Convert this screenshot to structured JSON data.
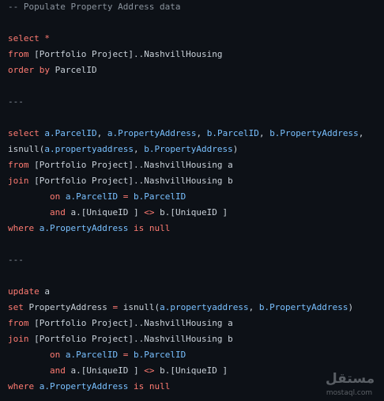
{
  "code_lines": [
    [
      {
        "t": "cm",
        "v": "-- Populate Property Address data"
      }
    ],
    [],
    [
      {
        "t": "kw",
        "v": "select"
      },
      {
        "t": "txt",
        "v": " "
      },
      {
        "t": "kw",
        "v": "*"
      }
    ],
    [
      {
        "t": "kw",
        "v": "from"
      },
      {
        "t": "txt",
        "v": " [Portfolio Project]..NashvillHousing"
      }
    ],
    [
      {
        "t": "kw",
        "v": "order by"
      },
      {
        "t": "txt",
        "v": " ParcelID"
      }
    ],
    [],
    [
      {
        "t": "cm",
        "v": "---"
      }
    ],
    [],
    [
      {
        "t": "kw",
        "v": "select"
      },
      {
        "t": "txt",
        "v": " "
      },
      {
        "t": "id",
        "v": "a.ParcelID"
      },
      {
        "t": "txt",
        "v": ", "
      },
      {
        "t": "id",
        "v": "a.PropertyAddress"
      },
      {
        "t": "txt",
        "v": ", "
      },
      {
        "t": "id",
        "v": "b.ParcelID"
      },
      {
        "t": "txt",
        "v": ", "
      },
      {
        "t": "id",
        "v": "b.PropertyAddress"
      },
      {
        "t": "txt",
        "v": ","
      }
    ],
    [
      {
        "t": "txt",
        "v": "isnull("
      },
      {
        "t": "id",
        "v": "a.propertyaddress"
      },
      {
        "t": "txt",
        "v": ", "
      },
      {
        "t": "id",
        "v": "b.PropertyAddress"
      },
      {
        "t": "txt",
        "v": ")"
      }
    ],
    [
      {
        "t": "kw",
        "v": "from"
      },
      {
        "t": "txt",
        "v": " [Portfolio Project]..NashvillHousing a"
      }
    ],
    [
      {
        "t": "kw",
        "v": "join"
      },
      {
        "t": "txt",
        "v": " [Portfolio Project]..NashvillHousing b"
      }
    ],
    [
      {
        "t": "txt",
        "v": "        "
      },
      {
        "t": "kw",
        "v": "on"
      },
      {
        "t": "txt",
        "v": " "
      },
      {
        "t": "id",
        "v": "a.ParcelID"
      },
      {
        "t": "txt",
        "v": " "
      },
      {
        "t": "kw",
        "v": "="
      },
      {
        "t": "txt",
        "v": " "
      },
      {
        "t": "id",
        "v": "b.ParcelID"
      }
    ],
    [
      {
        "t": "txt",
        "v": "        "
      },
      {
        "t": "kw",
        "v": "and"
      },
      {
        "t": "txt",
        "v": " a.[UniqueID ] "
      },
      {
        "t": "kw",
        "v": "<>"
      },
      {
        "t": "txt",
        "v": " b.[UniqueID ]"
      }
    ],
    [
      {
        "t": "kw",
        "v": "where"
      },
      {
        "t": "txt",
        "v": " "
      },
      {
        "t": "id",
        "v": "a.PropertyAddress"
      },
      {
        "t": "txt",
        "v": " "
      },
      {
        "t": "kw",
        "v": "is null"
      }
    ],
    [],
    [
      {
        "t": "cm",
        "v": "---"
      }
    ],
    [],
    [
      {
        "t": "kw",
        "v": "update"
      },
      {
        "t": "txt",
        "v": " a"
      }
    ],
    [
      {
        "t": "kw",
        "v": "set"
      },
      {
        "t": "txt",
        "v": " PropertyAddress "
      },
      {
        "t": "kw",
        "v": "="
      },
      {
        "t": "txt",
        "v": " isnull("
      },
      {
        "t": "id",
        "v": "a.propertyaddress"
      },
      {
        "t": "txt",
        "v": ", "
      },
      {
        "t": "id",
        "v": "b.PropertyAddress"
      },
      {
        "t": "txt",
        "v": ")"
      }
    ],
    [
      {
        "t": "kw",
        "v": "from"
      },
      {
        "t": "txt",
        "v": " [Portfolio Project]..NashvillHousing a"
      }
    ],
    [
      {
        "t": "kw",
        "v": "join"
      },
      {
        "t": "txt",
        "v": " [Portfolio Project]..NashvillHousing b"
      }
    ],
    [
      {
        "t": "txt",
        "v": "        "
      },
      {
        "t": "kw",
        "v": "on"
      },
      {
        "t": "txt",
        "v": " "
      },
      {
        "t": "id",
        "v": "a.ParcelID"
      },
      {
        "t": "txt",
        "v": " "
      },
      {
        "t": "kw",
        "v": "="
      },
      {
        "t": "txt",
        "v": " "
      },
      {
        "t": "id",
        "v": "b.ParcelID"
      }
    ],
    [
      {
        "t": "txt",
        "v": "        "
      },
      {
        "t": "kw",
        "v": "and"
      },
      {
        "t": "txt",
        "v": " a.[UniqueID ] "
      },
      {
        "t": "kw",
        "v": "<>"
      },
      {
        "t": "txt",
        "v": " b.[UniqueID ]"
      }
    ],
    [
      {
        "t": "kw",
        "v": "where"
      },
      {
        "t": "txt",
        "v": " "
      },
      {
        "t": "id",
        "v": "a.PropertyAddress"
      },
      {
        "t": "txt",
        "v": " "
      },
      {
        "t": "kw",
        "v": "is null"
      }
    ]
  ],
  "watermark": {
    "arabic": "مستقل",
    "latin": "mostaql.com"
  },
  "colors": {
    "background": "#0d1117",
    "keyword": "#ff7b72",
    "comment": "#8b949e",
    "identifier": "#79c0ff",
    "text": "#c9d1d9"
  }
}
